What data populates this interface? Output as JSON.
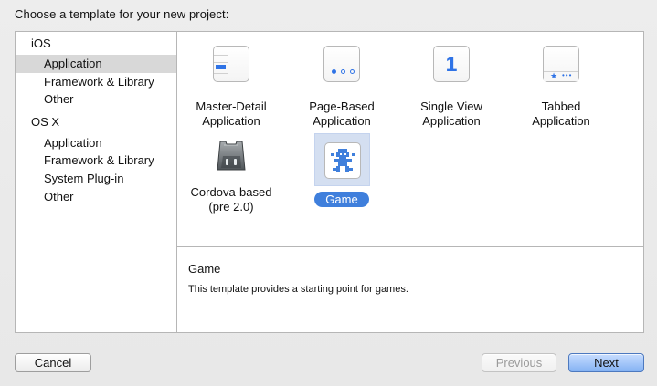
{
  "window": {
    "title": "Choose a template for your new project:"
  },
  "sidebar": {
    "sections": [
      {
        "title": "iOS",
        "items": [
          {
            "label": "Application",
            "selected": true
          },
          {
            "label": "Framework & Library",
            "selected": false
          },
          {
            "label": "Other",
            "selected": false
          }
        ]
      },
      {
        "title": "OS X",
        "items": [
          {
            "label": "Application",
            "selected": false
          },
          {
            "label": "Framework & Library",
            "selected": false
          },
          {
            "label": "System Plug-in",
            "selected": false
          },
          {
            "label": "Other",
            "selected": false
          }
        ]
      }
    ]
  },
  "templates": [
    {
      "label": "Master-Detail\nApplication",
      "icon": "master-detail-icon"
    },
    {
      "label": "Page-Based\nApplication",
      "icon": "page-based-icon"
    },
    {
      "label": "Single View\nApplication",
      "icon": "single-view-icon",
      "number": "1"
    },
    {
      "label": "Tabbed\nApplication",
      "icon": "tabbed-icon"
    },
    {
      "label": "Cordova-based\n(pre 2.0)",
      "icon": "cordova-icon"
    },
    {
      "label": "Game",
      "icon": "game-icon",
      "selected": true
    }
  ],
  "description": {
    "title": "Game",
    "text": "This template provides a starting point for games."
  },
  "buttons": {
    "cancel": "Cancel",
    "previous": "Previous",
    "next": "Next"
  },
  "colors": {
    "accent": "#3f7fdc",
    "selection_background": "#d4dff1",
    "sidebar_selected": "#d8d8d8",
    "border": "#b6b6b6"
  }
}
